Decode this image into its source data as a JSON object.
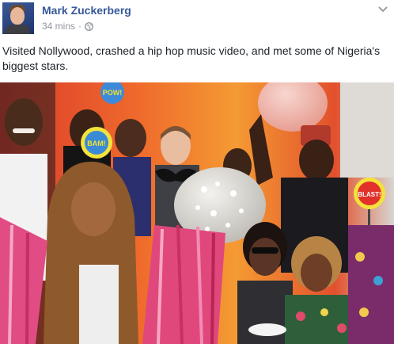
{
  "post": {
    "author_name": "Mark Zuckerberg",
    "timestamp": "34 mins",
    "separator": "·",
    "privacy_icon": "globe-icon",
    "options_icon": "chevron-down-icon",
    "caption": "Visited Nollywood, crashed a hip hop music video, and met some of Nigeria's biggest stars."
  },
  "photo": {
    "description_icon": "group-photo",
    "props": {
      "sign_pow": "POW!",
      "sign_boom": "BAM!",
      "sign_blast": "BLAST!"
    }
  },
  "colors": {
    "link_blue": "#365899",
    "meta_gray": "#90949c",
    "text": "#1d2129",
    "wall_red": "#e8462b",
    "wall_orange": "#f28a2a"
  }
}
